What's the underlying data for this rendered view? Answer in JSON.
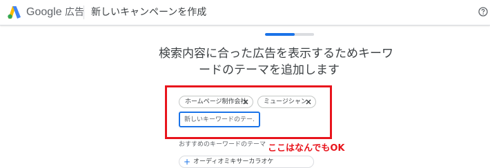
{
  "header": {
    "brand_google": "Google",
    "brand_product": "広告",
    "title": "新しいキャンペーンを作成",
    "help_icon": "help-circle-icon"
  },
  "progress": {
    "fraction": 0.6
  },
  "main": {
    "heading_line1": "検索内容に合った広告を表示するためキーワ",
    "heading_line2": "ードのテーマを追加します"
  },
  "keywords": {
    "chips": [
      {
        "label": "ホームページ制作会社"
      },
      {
        "label": "ミュージシャン"
      }
    ],
    "input_placeholder": "新しいキーワードのテー…"
  },
  "suggestions": {
    "label": "おすすめのキーワードのテーマ",
    "items": [
      {
        "label": "オーディオミキサーカラオケ"
      }
    ]
  },
  "annotation": {
    "text": "ここはなんでもOK",
    "color": "#e8141c"
  },
  "colors": {
    "accent": "#1a73e8",
    "annotation": "#e8141c"
  }
}
